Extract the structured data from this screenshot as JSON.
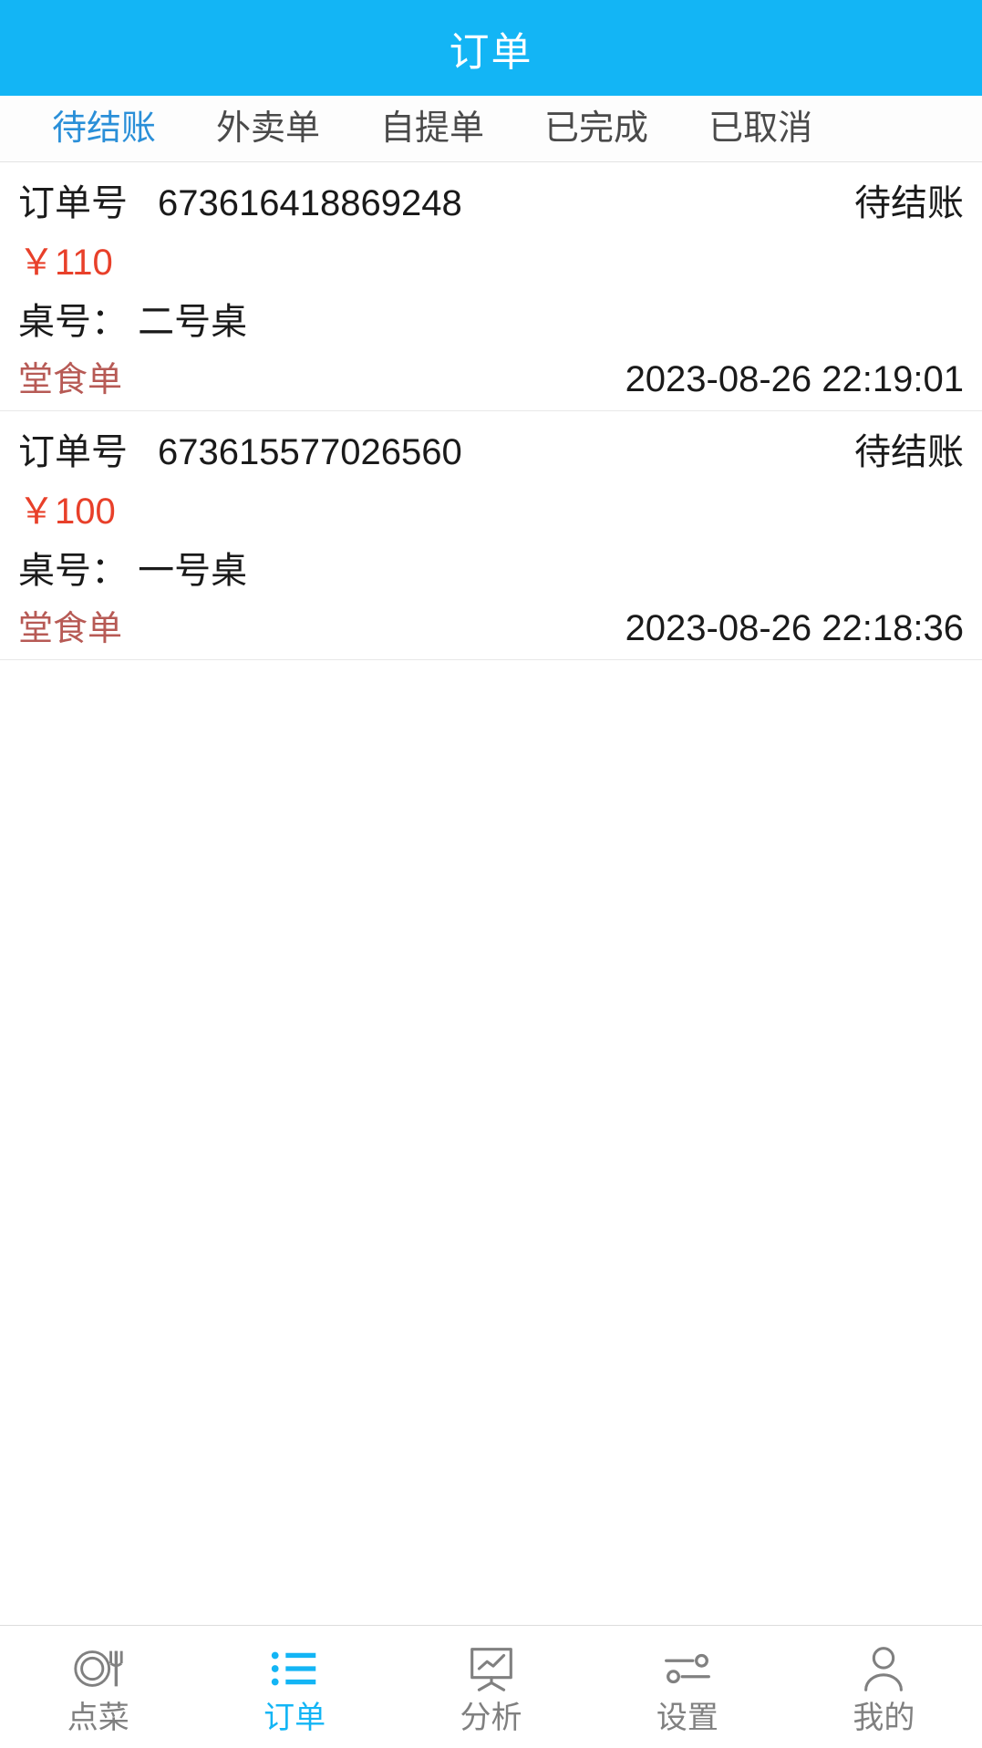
{
  "header": {
    "title": "订单",
    "bg_color": "#13B5F5",
    "title_color": "#FFFFFF"
  },
  "tabs": {
    "active_color": "#2A8FD8",
    "inactive_color": "#4A4A4A",
    "items": [
      {
        "label": "待结账",
        "active": true
      },
      {
        "label": "外卖单",
        "active": false
      },
      {
        "label": "自提单",
        "active": false
      },
      {
        "label": "已完成",
        "active": false
      },
      {
        "label": "已取消",
        "active": false
      }
    ]
  },
  "orders": {
    "order_no_label": "订单号",
    "table_label_prefix": "桌号：",
    "price_color": "#E8402A",
    "type_color": "#B75A55",
    "items": [
      {
        "order_no": "673616418869248",
        "status": "待结账",
        "price": "￥110",
        "table": "桌号： 二号桌",
        "order_type": "堂食单",
        "time": "2023-08-26 22:19:01"
      },
      {
        "order_no": "673615577026560",
        "status": "待结账",
        "price": "￥100",
        "table": "桌号： 一号桌",
        "order_type": "堂食单",
        "time": "2023-08-26 22:18:36"
      }
    ]
  },
  "bottom_nav": {
    "active_color": "#13B5F5",
    "inactive_color": "#808080",
    "items": [
      {
        "label": "点菜",
        "icon": "plate-fork-icon",
        "active": false
      },
      {
        "label": "订单",
        "icon": "list-icon",
        "active": true
      },
      {
        "label": "分析",
        "icon": "chart-board-icon",
        "active": false
      },
      {
        "label": "设置",
        "icon": "sliders-icon",
        "active": false
      },
      {
        "label": "我的",
        "icon": "person-icon",
        "active": false
      }
    ]
  }
}
